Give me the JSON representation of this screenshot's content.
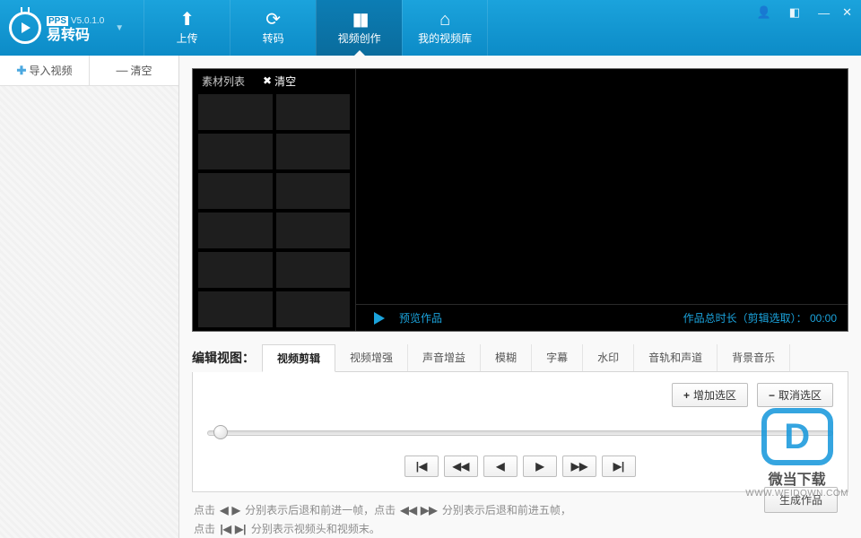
{
  "app": {
    "pps": "PPS",
    "version": "V5.0.1.0",
    "name": "易转码"
  },
  "nav": {
    "upload": "上传",
    "convert": "转码",
    "create": "视频创作",
    "library": "我的视频库"
  },
  "sidebar": {
    "import": "导入视频",
    "clear": "清空"
  },
  "stage": {
    "material_list": "素材列表",
    "clear": "清空",
    "preview_work": "预览作品",
    "total_prefix": "作品总时长（剪辑选取）：",
    "total_time": "00:00"
  },
  "edit": {
    "view_label": "编辑视图：",
    "tabs": {
      "clip": "视频剪辑",
      "enhance": "视频增强",
      "audio_gain": "声音增益",
      "blur": "模糊",
      "subtitle": "字幕",
      "watermark": "水印",
      "track": "音轨和声道",
      "bgm": "背景音乐"
    },
    "add_sel": "增加选区",
    "cancel_sel": "取消选区",
    "hint1_a": "点击",
    "hint1_b": "分别表示后退和前进一帧，点击",
    "hint1_c": "分别表示后退和前进五帧，",
    "hint2_a": "点击",
    "hint2_b": "分别表示视频头和视频末。",
    "generate": "生成作品"
  },
  "watermark": {
    "text": "微当下载",
    "url": "WWW.WEIDOWN.COM"
  }
}
